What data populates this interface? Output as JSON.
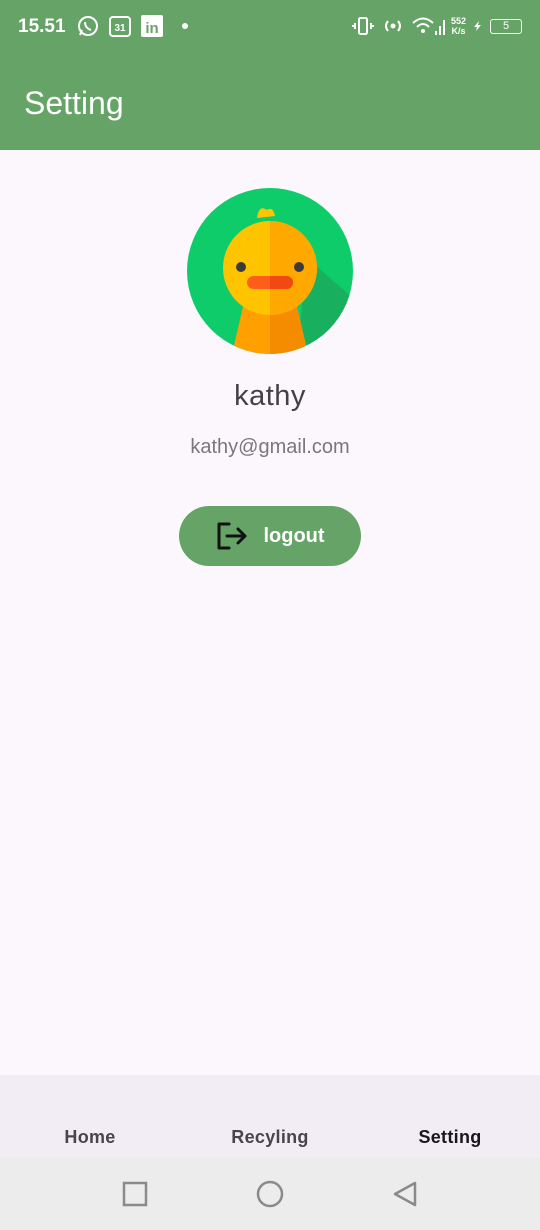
{
  "status_bar": {
    "time": "15.51",
    "left_icons": [
      "whatsapp-icon",
      "calendar-icon",
      "linkedin-icon"
    ],
    "calendar_day": "31",
    "linkedin_text": "in",
    "net_speed_value": "552",
    "net_speed_unit": "K/s",
    "battery_level": "5"
  },
  "app_bar": {
    "title": "Setting"
  },
  "profile": {
    "name": "kathy",
    "email": "kathy@gmail.com"
  },
  "logout": {
    "label": "logout"
  },
  "bottom_nav": {
    "items": [
      {
        "label": "Home",
        "active": false
      },
      {
        "label": "Recyling",
        "active": false
      },
      {
        "label": "Setting",
        "active": true
      }
    ]
  },
  "colors": {
    "primary": "#66a366",
    "background": "#fcf7fc",
    "avatar_bg": "#0fcc6a"
  }
}
